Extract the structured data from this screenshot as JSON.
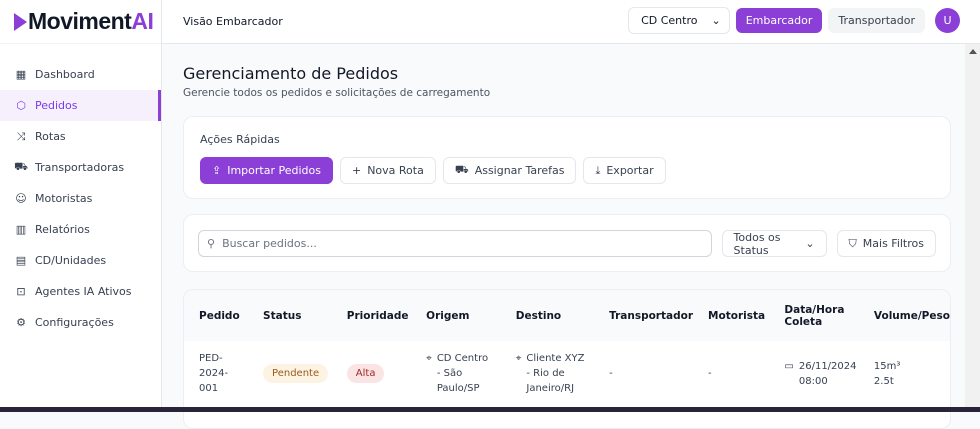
{
  "brand": {
    "name": "Moviment",
    "ai": "AI",
    "accent": "#8b3fd6"
  },
  "sidebar": {
    "items": [
      {
        "label": "Dashboard",
        "icon": "dashboard-icon"
      },
      {
        "label": "Pedidos",
        "icon": "package-icon",
        "active": true
      },
      {
        "label": "Rotas",
        "icon": "route-icon"
      },
      {
        "label": "Transportadoras",
        "icon": "truck-icon"
      },
      {
        "label": "Motoristas",
        "icon": "users-icon"
      },
      {
        "label": "Relatórios",
        "icon": "chart-icon"
      },
      {
        "label": "CD/Unidades",
        "icon": "building-icon"
      },
      {
        "label": "Agentes IA Ativos",
        "icon": "bot-icon"
      },
      {
        "label": "Configurações",
        "icon": "gear-icon"
      }
    ]
  },
  "header": {
    "title": "Visão Embarcador",
    "cd_select": "CD Centro",
    "embarcador": "Embarcador",
    "transportador": "Transportador",
    "avatar": "U"
  },
  "page": {
    "title": "Gerenciamento de Pedidos",
    "subtitle": "Gerencie todos os pedidos e solicitações de carregamento"
  },
  "quick": {
    "label": "Ações Rápidas",
    "import": "Importar Pedidos",
    "new_route": "Nova Rota",
    "assign": "Assignar Tarefas",
    "export": "Exportar"
  },
  "filters": {
    "search_placeholder": "Buscar pedidos...",
    "status": "Todos os Status",
    "more": "Mais Filtros"
  },
  "table": {
    "headers": [
      "Pedido",
      "Status",
      "Prioridade",
      "Origem",
      "Destino",
      "Transportador",
      "Motorista",
      "Data/Hora Coleta",
      "Volume/Peso"
    ],
    "rows": [
      {
        "pedido": "PED-2024-001",
        "status": "Pendente",
        "prioridade": "Alta",
        "origem": "CD Centro - São Paulo/SP",
        "destino": "Cliente XYZ - Rio de Janeiro/RJ",
        "transportador": "-",
        "motorista": "-",
        "data": "26/11/2024",
        "hora": "08:00",
        "volume": "15m³",
        "peso": "2.5t"
      }
    ]
  }
}
